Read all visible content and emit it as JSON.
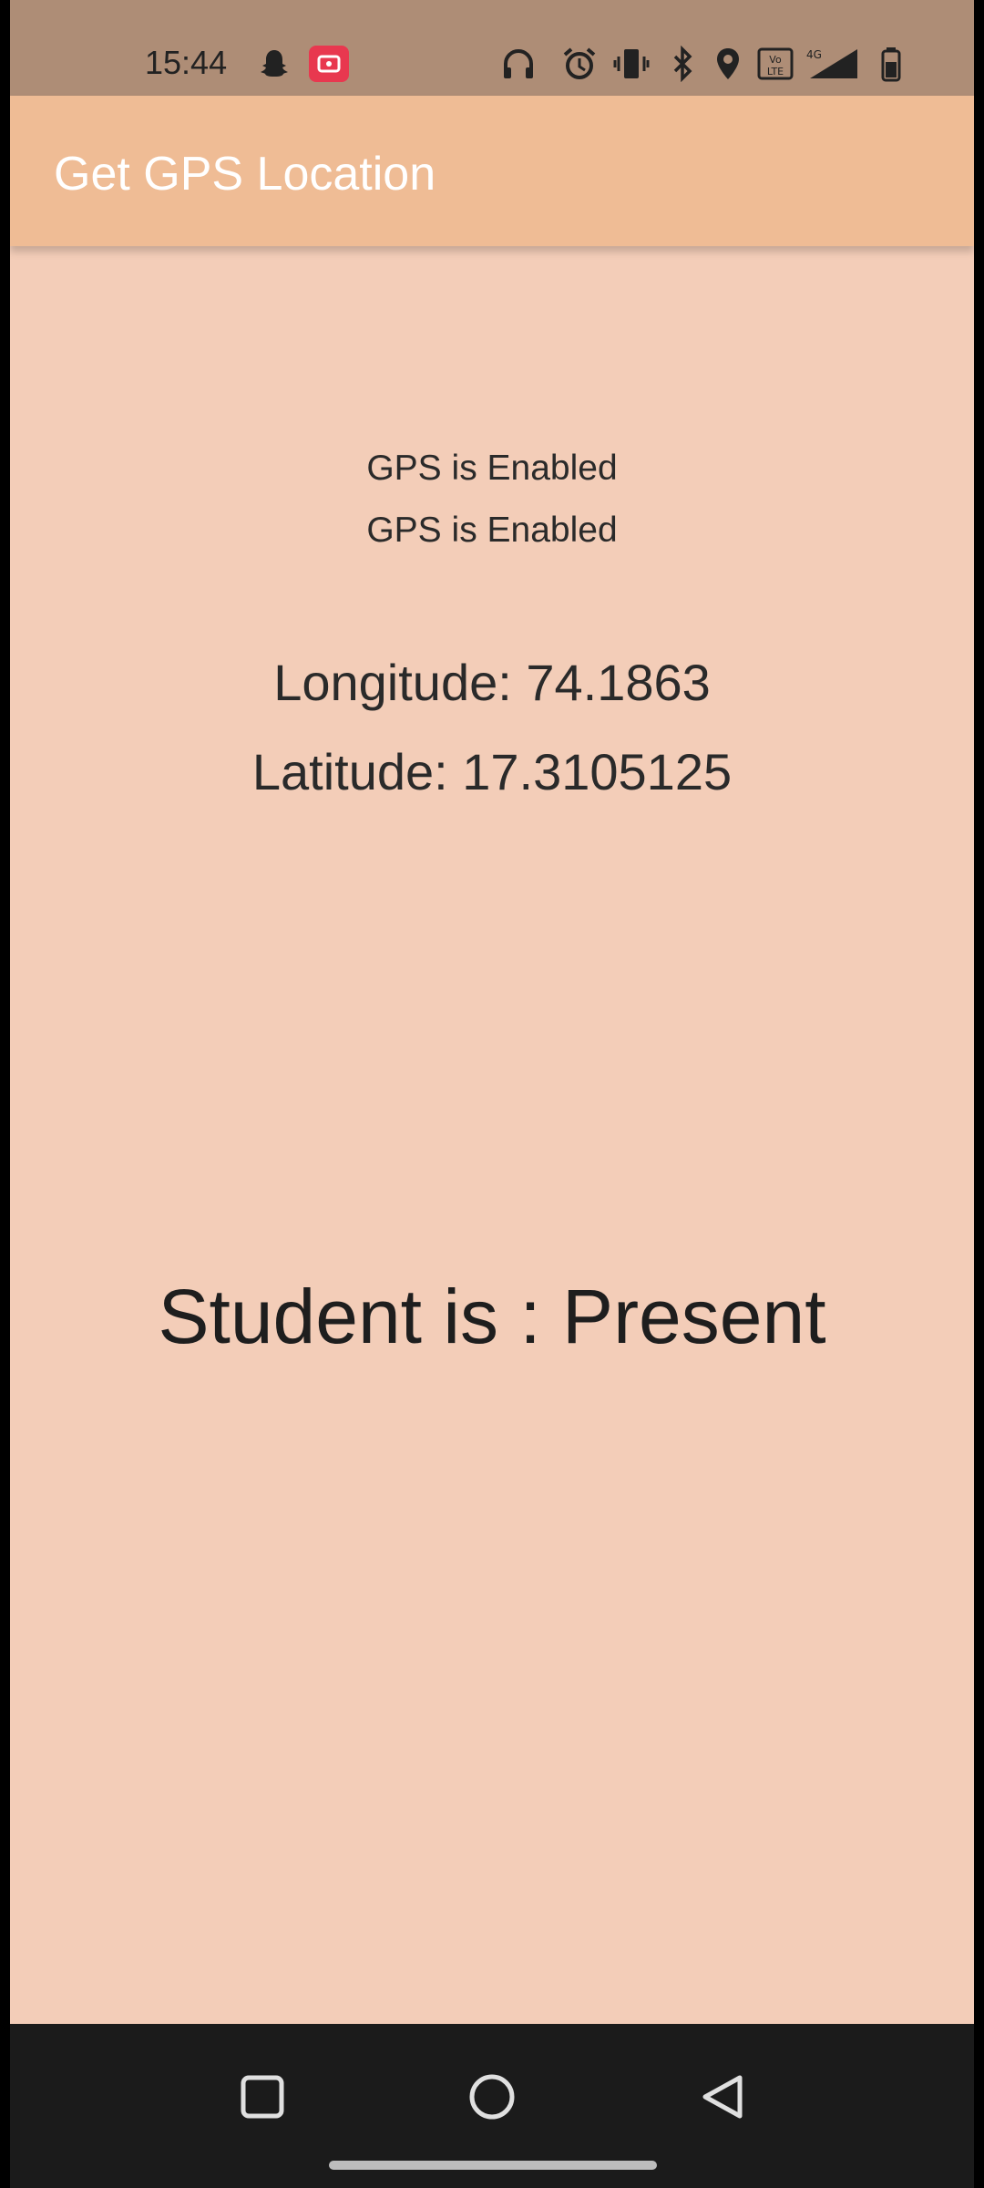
{
  "status_bar": {
    "time": "15:44",
    "icons": [
      "snapchat-icon",
      "screen-record-icon",
      "headphones-icon",
      "alarm-icon",
      "vibrate-icon",
      "bluetooth-icon",
      "location-icon",
      "volte-icon",
      "signal-4g-icon",
      "battery-icon"
    ],
    "screen_record_color": "#e8384f"
  },
  "app_bar": {
    "title": "Get GPS Location",
    "color": "#efbc95"
  },
  "content": {
    "gps_status_1": "GPS is Enabled",
    "gps_status_2": "GPS is Enabled",
    "longitude": "Longitude: 74.1863",
    "latitude": "Latitude: 17.3105125",
    "attendance": "Student is : Present",
    "background": "#f3cdb8"
  },
  "nav_bar": {
    "buttons": [
      "recent-apps-icon",
      "home-icon",
      "back-icon"
    ]
  }
}
